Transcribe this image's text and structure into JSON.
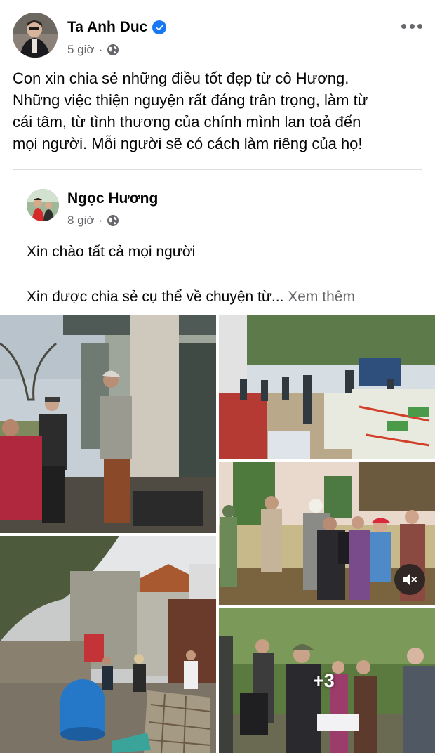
{
  "post": {
    "author": "Ta Anh Duc",
    "time": "5 giờ",
    "lines": [
      "Con xin chia sẻ những điều tốt đẹp từ cô Hương.",
      "Những việc thiện nguyện rất đáng trân trọng, làm từ",
      "cái tâm, từ tình thương của chính mình lan toả đến",
      "mọi người. Mỗi người sẽ có cách làm riêng của họ!"
    ]
  },
  "shared": {
    "author": "Ngọc Hương",
    "time": "8 giờ",
    "line1": "Xin chào tất cả mọi người",
    "line2": "Xin được chia sẻ cụ thể về chuyện từ...",
    "see_more": "Xem thêm"
  },
  "photos": {
    "more_count": "+3"
  },
  "icons": {
    "verified": "verified-badge-icon",
    "globe": "globe-icon",
    "more": "more-options-icon",
    "mute": "muted-speaker-icon"
  },
  "colors": {
    "verified_blue": "#1877f2",
    "secondary_text": "#65676b"
  }
}
